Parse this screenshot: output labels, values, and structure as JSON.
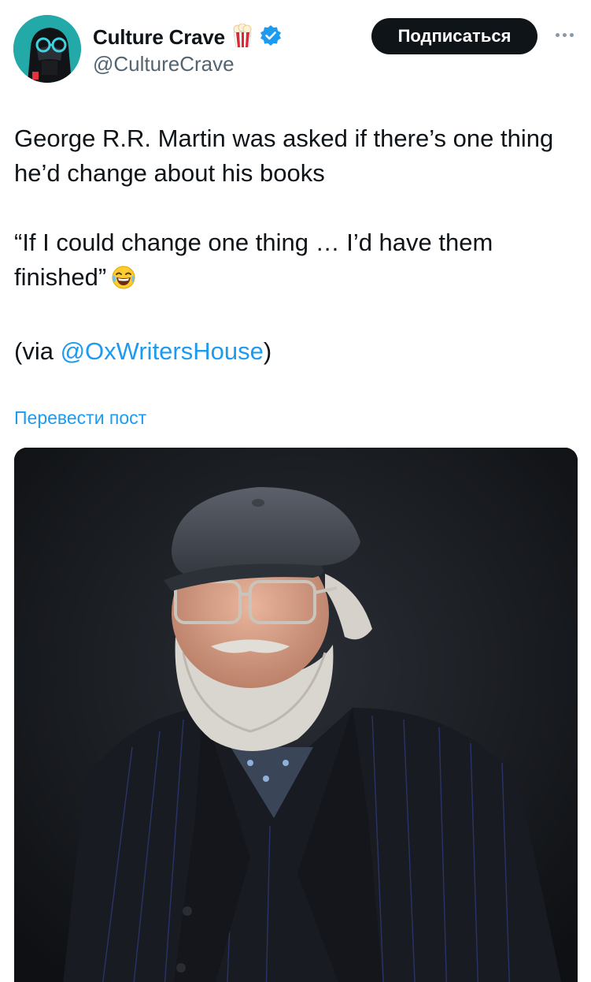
{
  "author": {
    "display_name": "Culture Crave",
    "handle": "@CultureCrave",
    "badge_emoji": "popcorn-icon",
    "verified_icon": "verified-badge-icon"
  },
  "actions": {
    "follow_label": "Подписаться",
    "more_icon": "more-dots-icon"
  },
  "tweet": {
    "line1": "George R.R. Martin was asked if there’s one thing he’d change about his books",
    "line2": "“If I could change one thing … I’d have them finished”",
    "line2_emoji": "laughing-tears-emoji",
    "line3_prefix": "(via ",
    "line3_mention": "@OxWritersHouse",
    "line3_suffix": ")"
  },
  "translate_label": "Перевести пост",
  "colors": {
    "accent": "#1d9bf0",
    "text": "#0f1419",
    "muted": "#536471",
    "button_bg": "#0f1419"
  }
}
